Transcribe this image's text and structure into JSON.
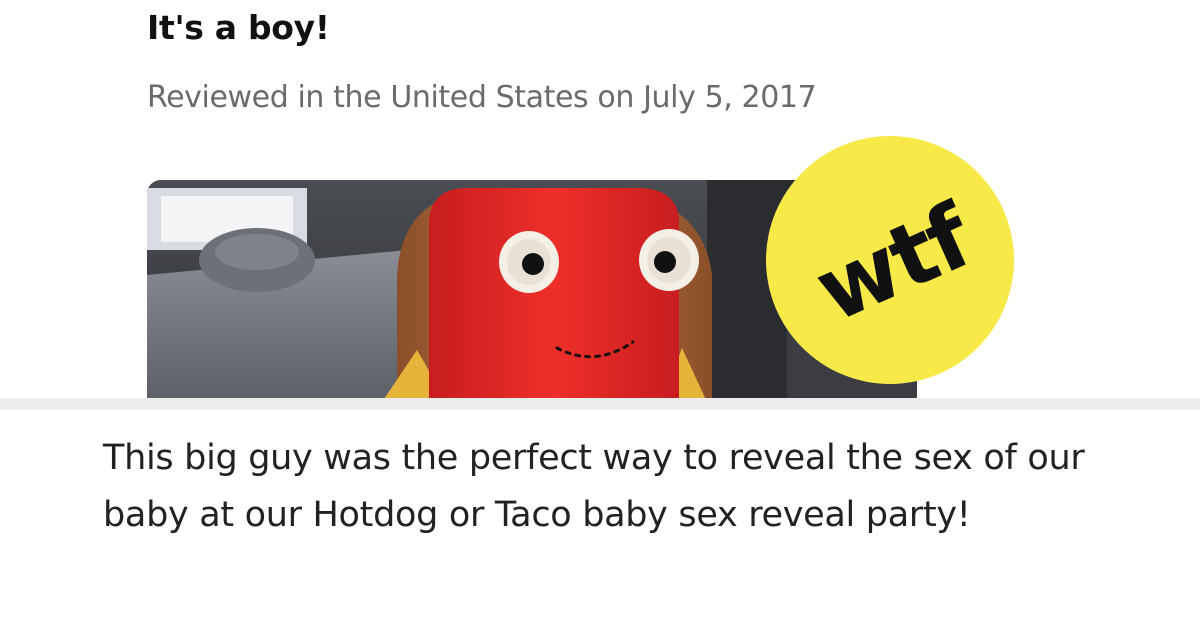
{
  "review": {
    "title": "It's a boy!",
    "meta": "Reviewed in the United States on July 5, 2017",
    "photo_subject": "hotdog plush with googly eyes",
    "body": "This big guy was the perfect way to reveal the sex of our baby at our Hotdog or Taco baby sex reveal party!"
  },
  "badge": {
    "label": "wtf",
    "color": "#f7ea48"
  },
  "colors": {
    "hotdog_red": "#e02a26",
    "bun_brown": "#b06a3c",
    "divider": "#eceeee"
  }
}
